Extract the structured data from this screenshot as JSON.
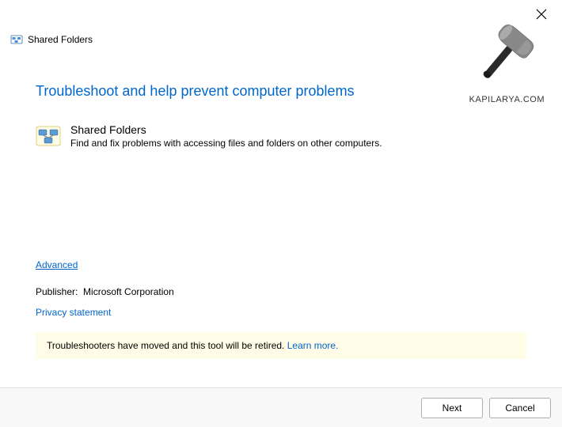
{
  "titlebar": {
    "title": "Shared Folders"
  },
  "watermark": {
    "text": "KAPILARYA.COM"
  },
  "main": {
    "heading": "Troubleshoot and help prevent computer problems",
    "section": {
      "title": "Shared Folders",
      "description": "Find and fix problems with accessing files and folders on other computers."
    },
    "advanced_label": "Advanced",
    "publisher_label": "Publisher:",
    "publisher_value": "Microsoft Corporation",
    "privacy_label": "Privacy statement",
    "notice": {
      "text": "Troubleshooters have moved and this tool will be retired. ",
      "learn_more": "Learn more."
    }
  },
  "buttons": {
    "next": "Next",
    "cancel": "Cancel"
  }
}
